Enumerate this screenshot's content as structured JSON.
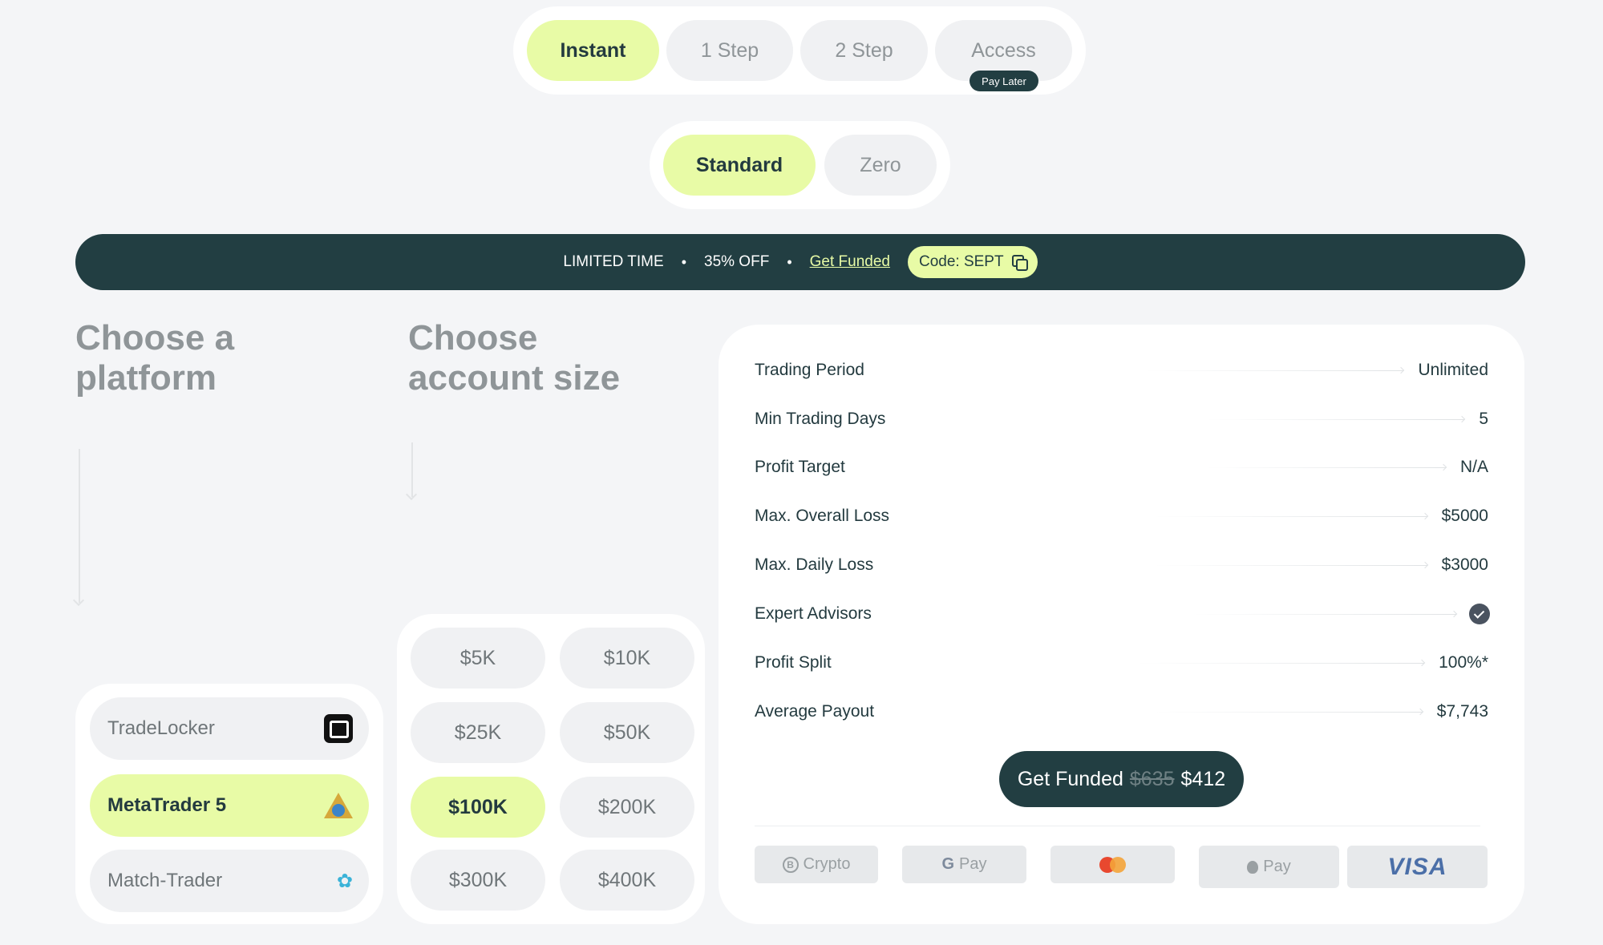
{
  "program_tabs": [
    {
      "label": "Instant",
      "active": true
    },
    {
      "label": "1 Step",
      "active": false
    },
    {
      "label": "2 Step",
      "active": false
    },
    {
      "label": "Access",
      "active": false,
      "badge": "Pay Later"
    }
  ],
  "account_types": [
    {
      "label": "Standard",
      "active": true
    },
    {
      "label": "Zero",
      "active": false
    }
  ],
  "banner": {
    "limited": "LIMITED TIME",
    "bullet": "•",
    "discount": "35% OFF",
    "link": "Get Funded",
    "code": "Code: SEPT",
    "code_icon": "copy-icon"
  },
  "headings": {
    "platform": [
      "Choose a",
      "platform"
    ],
    "size": [
      "Choose",
      "account size"
    ]
  },
  "platforms": [
    {
      "label": "TradeLocker",
      "icon": "tradelocker-icon",
      "active": false
    },
    {
      "label": "MetaTrader 5",
      "icon": "metatrader-icon",
      "active": true
    },
    {
      "label": "Match-Trader",
      "icon": "match-trader-icon",
      "active": false
    }
  ],
  "sizes": [
    {
      "label": "$5K",
      "active": false
    },
    {
      "label": "$10K",
      "active": false
    },
    {
      "label": "$25K",
      "active": false
    },
    {
      "label": "$50K",
      "active": false
    },
    {
      "label": "$100K",
      "active": true
    },
    {
      "label": "$200K",
      "active": false
    },
    {
      "label": "$300K",
      "active": false
    },
    {
      "label": "$400K",
      "active": false
    }
  ],
  "details": [
    {
      "label": "Trading Period",
      "value": "Unlimited"
    },
    {
      "label": "Min Trading Days",
      "value": "5"
    },
    {
      "label": "Profit Target",
      "value": "N/A"
    },
    {
      "label": "Max. Overall Loss",
      "value": "$5000"
    },
    {
      "label": "Max. Daily Loss",
      "value": "$3000"
    },
    {
      "label": "Expert Advisors",
      "value": "",
      "icon": "check-badge-icon"
    },
    {
      "label": "Profit Split",
      "value": "100%*"
    },
    {
      "label": "Average Payout",
      "value": "$7,743"
    }
  ],
  "cta": {
    "label": "Get Funded",
    "old_price": "$635",
    "price": "$412"
  },
  "payments": {
    "crypto": "Crypto",
    "crypto_symbol": "B",
    "gpay_g": "G",
    "gpay": "Pay",
    "apple": "Pay",
    "visa": "VISA"
  },
  "colors": {
    "accent": "#e8fba6",
    "dark": "#223e42",
    "background": "#f4f5f7"
  }
}
